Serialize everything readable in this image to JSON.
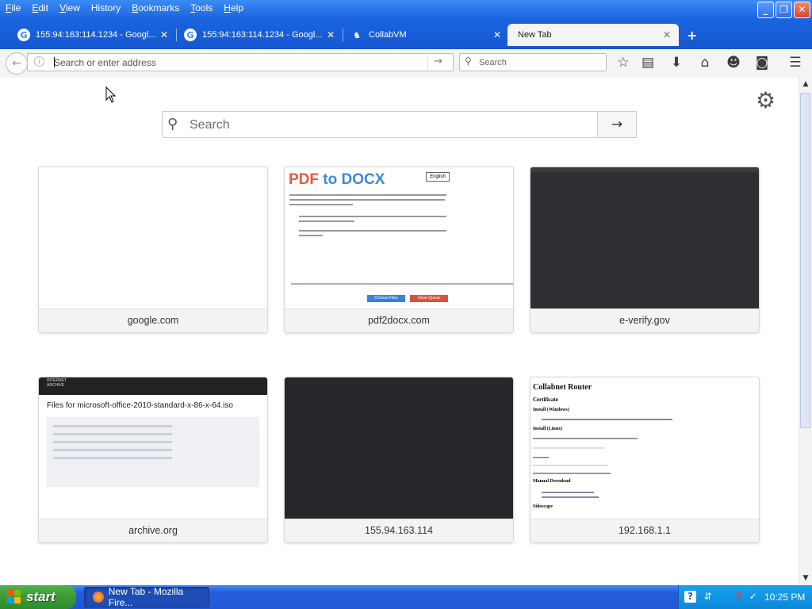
{
  "menubar": {
    "items": [
      {
        "accel": "F",
        "rest": "ile"
      },
      {
        "accel": "E",
        "rest": "dit"
      },
      {
        "accel": "V",
        "rest": "iew"
      },
      {
        "accel": "",
        "rest": "History",
        "accel_after": "H"
      },
      {
        "accel": "B",
        "rest": "ookmarks"
      },
      {
        "accel": "T",
        "rest": "ools"
      },
      {
        "accel": "H",
        "rest": "elp"
      }
    ]
  },
  "window_buttons": {
    "minimize": "_",
    "maximize": "❐",
    "close": "✕"
  },
  "tabs": [
    {
      "title": "155:94:163:114.1234 - Googl...",
      "icon": "G",
      "close": "✕"
    },
    {
      "title": "155:94:163:114.1234 - Googl...",
      "icon": "G",
      "close": "✕"
    },
    {
      "title": "CollabVM",
      "icon": "♞",
      "close": "✕"
    },
    {
      "title": "New Tab",
      "close": "✕"
    }
  ],
  "new_tab_label": "+",
  "navbar": {
    "back_icon": "←",
    "info_icon": "i",
    "url_placeholder": "Search or enter address",
    "go_icon": "→",
    "search_placeholder": "Search",
    "search_icon": "⚲",
    "icons": {
      "bookmark": "☆",
      "reader": "▤",
      "download": "⬇",
      "home": "⌂",
      "chat": "☻",
      "pocket": "◙",
      "menu": "☰"
    }
  },
  "content": {
    "settings_icon": "⚙",
    "search_placeholder": "Search",
    "search_icon": "⚲",
    "search_go": "→",
    "tiles": [
      {
        "label": "google.com",
        "thumb": "blank"
      },
      {
        "label": "pdf2docx.com",
        "thumb": "pdf"
      },
      {
        "label": "e-verify.gov",
        "thumb": "dark"
      },
      {
        "label": "archive.org",
        "thumb": "archive"
      },
      {
        "label": "155.94.163.114",
        "thumb": "dark2"
      },
      {
        "label": "192.168.1.1",
        "thumb": "router"
      }
    ],
    "pdf_thumb": {
      "logo_left": "PDF",
      "logo_mid": "to",
      "logo_right": "DOCX",
      "lang": "English",
      "button_left": "Choose Files",
      "button_right": "Clear Queue"
    },
    "archive_thumb": {
      "brand": "INTERNET ARCHIVE",
      "title": "Files for microsoft-office-2010-standard-x-86-x-64.iso"
    },
    "router_thumb": {
      "title": "Collabnet Router",
      "h_certificate": "Certificate",
      "h_install_windows": "Install (Windows)",
      "h_install_linux": "Install (Linux)",
      "h_manual": "Manual Download",
      "h_sidescape": "Sidescape"
    }
  },
  "scrollbar": {
    "up": "▲",
    "down": "▼"
  },
  "taskbar": {
    "start_label": "start",
    "task_label": "New Tab - Mozilla Fire...",
    "clock": "10:25 PM",
    "tray_icons": {
      "help": "?",
      "network": "⇵",
      "security": "⛨",
      "update": "✓"
    }
  }
}
